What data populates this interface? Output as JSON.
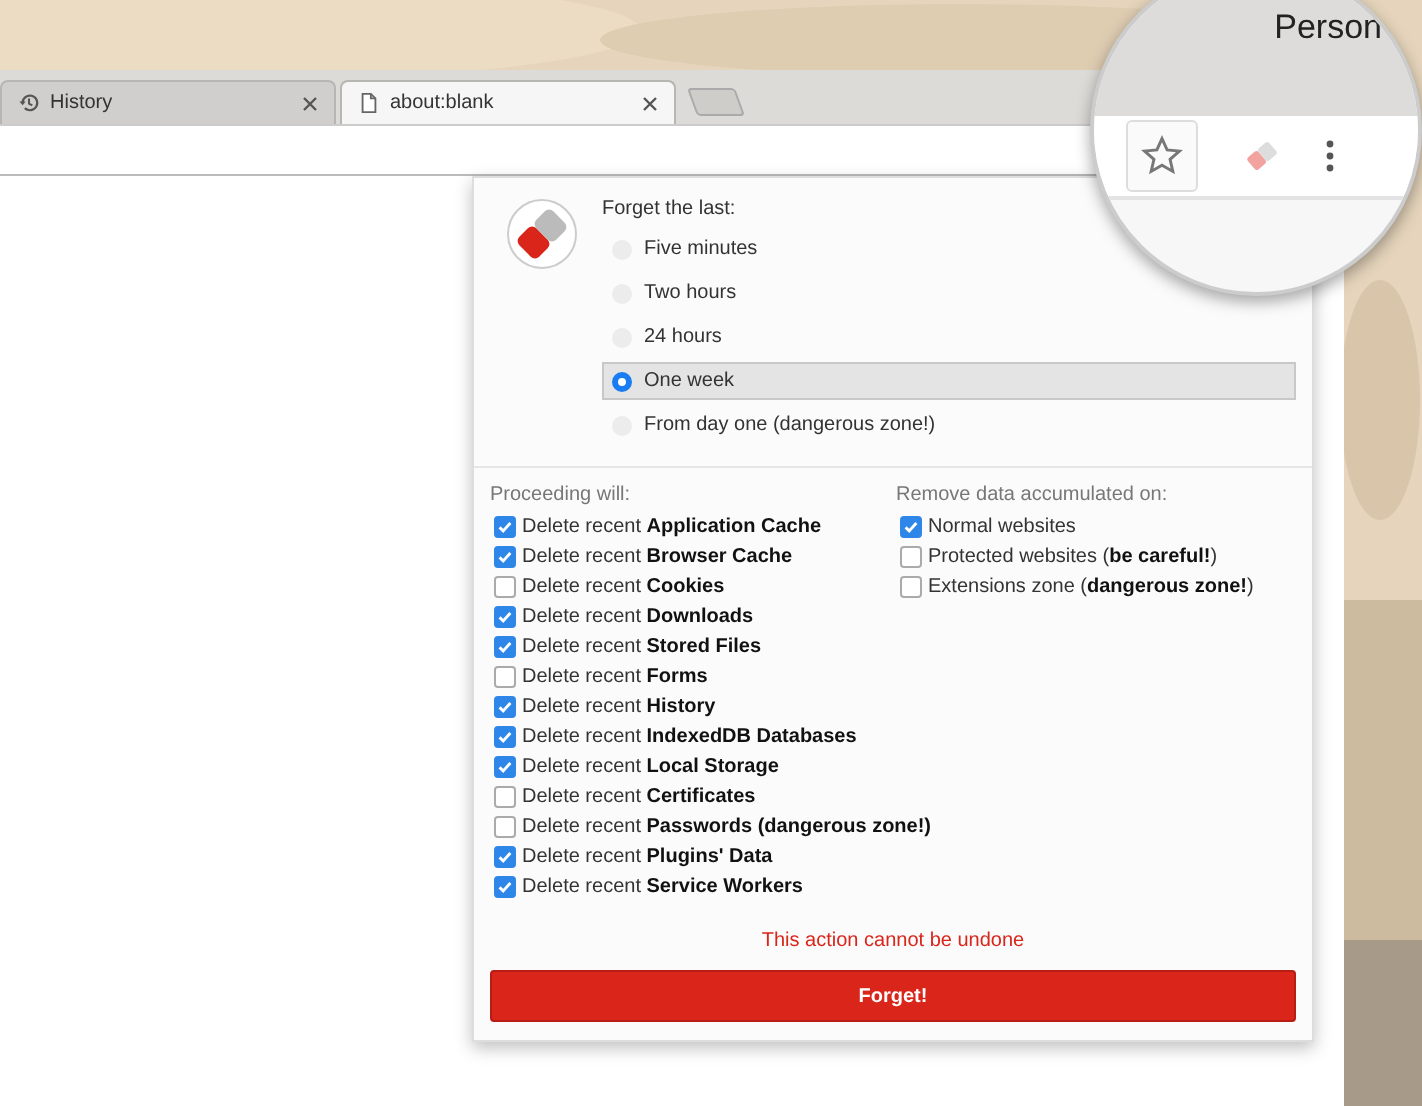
{
  "tabs": [
    {
      "title": "History",
      "kind": "history",
      "selected": false
    },
    {
      "title": "about:blank",
      "kind": "page",
      "selected": true
    }
  ],
  "magnifier": {
    "profile": "Person"
  },
  "popup": {
    "heading": "Forget the last:",
    "periods": [
      {
        "label": "Five minutes",
        "selected": false
      },
      {
        "label": "Two hours",
        "selected": false
      },
      {
        "label": "24 hours",
        "selected": false
      },
      {
        "label": "One week",
        "selected": true
      },
      {
        "label": "From day one (dangerous zone!)",
        "selected": false
      }
    ],
    "proceeding_heading": "Proceeding will:",
    "actions": [
      {
        "label": "Delete recent **Application Cache**",
        "checked": true
      },
      {
        "label": "Delete recent **Browser Cache**",
        "checked": true
      },
      {
        "label": "Delete recent **Cookies**",
        "checked": false
      },
      {
        "label": "Delete recent **Downloads**",
        "checked": true
      },
      {
        "label": "Delete recent **Stored Files**",
        "checked": true
      },
      {
        "label": "Delete recent **Forms**",
        "checked": false
      },
      {
        "label": "Delete recent **History**",
        "checked": true
      },
      {
        "label": "Delete recent **IndexedDB Databases**",
        "checked": true
      },
      {
        "label": "Delete recent **Local Storage**",
        "checked": true
      },
      {
        "label": "Delete recent **Certificates**",
        "checked": false
      },
      {
        "label": "Delete recent **Passwords (dangerous zone!)**",
        "checked": false
      },
      {
        "label": "Delete recent **Plugins' Data**",
        "checked": true
      },
      {
        "label": "Delete recent **Service Workers**",
        "checked": true
      }
    ],
    "origins_heading": "Remove data accumulated on:",
    "origins": [
      {
        "label": "Normal websites",
        "checked": true
      },
      {
        "label": "Protected websites (**be careful!**)",
        "checked": false
      },
      {
        "label": "Extensions zone (**dangerous zone!**)",
        "checked": false
      }
    ],
    "warning": "This action cannot be undone",
    "button": "Forget!"
  }
}
